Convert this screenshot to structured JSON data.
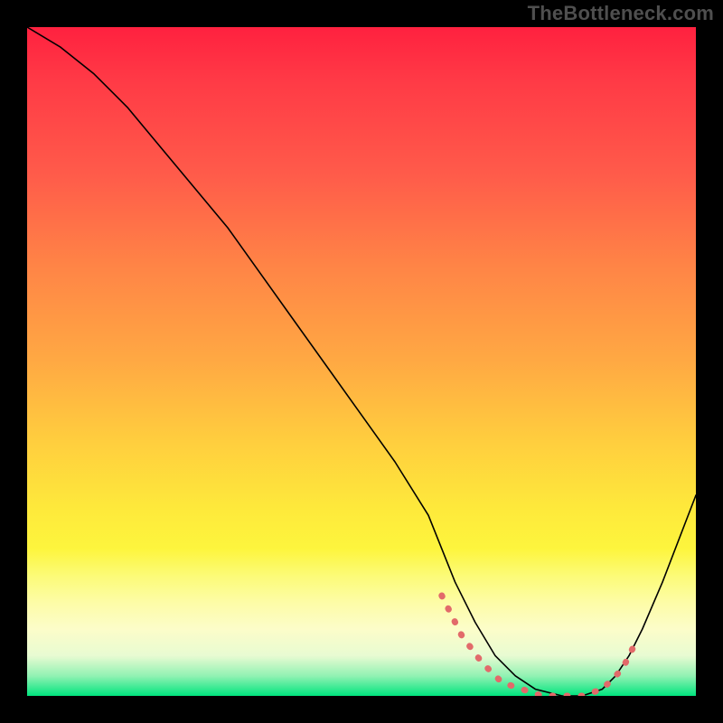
{
  "watermark": "TheBottleneck.com",
  "colors": {
    "curve": "#000000",
    "dashes": "#e26a6a",
    "background_black": "#000000",
    "gradient_stops": [
      "#ff213f",
      "#ff5b4a",
      "#ffa943",
      "#fee93b",
      "#fcfdc9",
      "#00e47e"
    ]
  },
  "chart_data": {
    "type": "line",
    "title": "",
    "xlabel": "",
    "ylabel": "",
    "xlim": [
      0,
      100
    ],
    "ylim": [
      0,
      100
    ],
    "grid": false,
    "series": [
      {
        "name": "bottleneck-curve",
        "x": [
          0,
          5,
          10,
          15,
          20,
          25,
          30,
          35,
          40,
          45,
          50,
          55,
          60,
          62,
          64,
          67,
          70,
          73,
          76,
          80,
          83,
          86,
          88,
          90,
          92,
          95,
          100
        ],
        "y": [
          100,
          97,
          93,
          88,
          82,
          76,
          70,
          63,
          56,
          49,
          42,
          35,
          27,
          22,
          17,
          11,
          6,
          3,
          1,
          0,
          0,
          1,
          3,
          6,
          10,
          17,
          30
        ]
      }
    ],
    "highlight_segment": {
      "name": "valley-dots",
      "x": [
        62,
        65,
        68,
        71,
        74,
        77,
        80,
        83,
        86,
        89,
        91
      ],
      "y": [
        15,
        9,
        5,
        2,
        1,
        0,
        0,
        0,
        1,
        4,
        8
      ]
    }
  }
}
